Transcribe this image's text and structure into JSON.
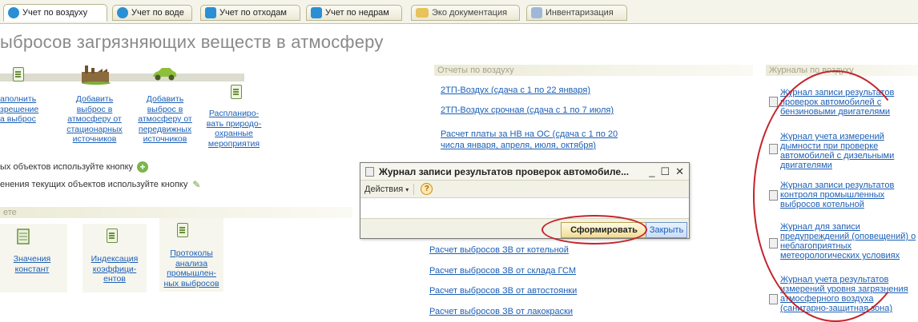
{
  "tabs": [
    {
      "label": "Учет по воздуху",
      "active": true,
      "icon": "globe-icon",
      "color": "#2a8fd4"
    },
    {
      "label": "Учет по воде",
      "active": false,
      "icon": "water-icon",
      "color": "#2a8fd4"
    },
    {
      "label": "Учет по отходам",
      "active": false,
      "icon": "waste-icon",
      "color": "#2a8fd4"
    },
    {
      "label": "Учет по недрам",
      "active": false,
      "icon": "subsoil-icon",
      "color": "#2a8fd4"
    },
    {
      "label": "Эко документация",
      "active": false,
      "icon": "folder-icon",
      "color": "#e8c25a"
    },
    {
      "label": "Инвентаризация",
      "active": false,
      "icon": "inventory-icon",
      "color": "#9fb8d8"
    }
  ],
  "page_title": "ыбросов загрязняющих веществ в атмосферу",
  "process_links": [
    "аполнить\nзрешение\nа выброс",
    "Добавить\nвыброс в\nатмосферу от\nстационарных\nисточников",
    "Добавить\nвыброс в\nатмосферу от\nпередвижных\nисточников",
    "Распланиро-\nвать природо-\nохранные\nмероприятия"
  ],
  "hints": {
    "add_objects": "ых объектов используйте кнопку",
    "edit_objects": "енения текущих объектов используйте кнопку"
  },
  "settings_section": {
    "header": "ете",
    "items": [
      "Значения\nконстант",
      "Индексация\nкоэффици-\nентов",
      "Протоколы\nанализа\nпромышлен-\nных выбросов"
    ]
  },
  "reports": {
    "header": "Отчеты по воздуху",
    "links_top": [
      "2ТП-Воздух (сдача с 1 по 22 января)",
      "2ТП-Воздух срочная (сдача с 1 по 7 июля)",
      "Расчет платы за НВ на ОС (сдача с 1 по 20\nчисла января, апреля, июля, октября)"
    ],
    "links_bottom": [
      "Расчет выбросов ЗВ от котельной",
      "Расчет выбросов ЗВ от склада ГСМ",
      "Расчет выбросов ЗВ от автостоянки",
      "Расчет выбросов ЗВ от лакокраски"
    ]
  },
  "journals": {
    "header": "Журналы по воздуху",
    "links": [
      "Журнал записи результатов\nпроверок автомобилей с\nбензиновыми двигателями",
      "Журнал учета измерений\nдымности при проверке\nавтомобилей с дизельными\nдвигателями",
      "Журнал записи результатов\nконтроля промышленных\nвыбросов котельной",
      "Журнал для записи\nпредупреждений (оповещений) о\nнеблагоприятных\nметеорологических условиях",
      "Журнал учета результатов\nизмерений уровня загрязнения\nатмосферного воздуха\n(санитарно-защитная зона)"
    ]
  },
  "dialog": {
    "title": "Журнал записи результатов проверок автомобиле...",
    "min": "_",
    "max": "☐",
    "close": "✕",
    "menu_label": "Действия",
    "help": "?",
    "form_button": "Сформировать",
    "close_button": "Закрыть"
  },
  "colors": {
    "link": "#1c5fb5",
    "annotation": "#c4232b",
    "section_header": "#a5a38c"
  }
}
